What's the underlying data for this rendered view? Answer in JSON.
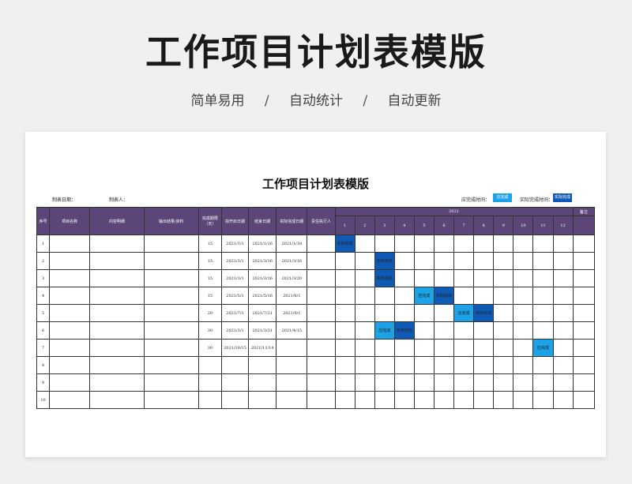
{
  "banner": {
    "title": "工作项目计划表模版",
    "features": [
      "简单易用",
      "自动统计",
      "自动更新"
    ],
    "separator": "/"
  },
  "doc": {
    "title": "工作项目计划表模版",
    "made_date_label": "制表日期：",
    "made_by_label": "制表人：",
    "legend_planned_label": "应完成时间：",
    "legend_planned_box": "应完成",
    "legend_actual_label": "实际完成时间：",
    "legend_actual_box": "实际完成"
  },
  "colors": {
    "header_bg": "#5b4677",
    "planned": "#1ca2e6",
    "actual": "#0f5ab4"
  },
  "table": {
    "headers": {
      "no": "序号",
      "name": "项目名称",
      "detail": "内容明细",
      "output": "输出结果/资料",
      "duration": "完成期限（天）",
      "start": "拟开启日期",
      "end": "结束日期",
      "actual_end": "实际完成日期",
      "owner": "责任执行人",
      "year": "2021",
      "remark": "备注"
    },
    "months": [
      "1",
      "2",
      "3",
      "4",
      "5",
      "6",
      "7",
      "8",
      "9",
      "10",
      "11",
      "12"
    ],
    "rows": [
      {
        "no": "1",
        "duration": "15",
        "start": "2021/1/1",
        "end": "2021/1/16",
        "actual_end": "2021/1/18",
        "planned_months": [],
        "actual_months": [
          1
        ]
      },
      {
        "no": "2",
        "duration": "15",
        "start": "2021/3/1",
        "end": "2021/3/16",
        "actual_end": "2021/3/16",
        "planned_months": [],
        "actual_months": [
          3
        ]
      },
      {
        "no": "3",
        "duration": "15",
        "start": "2021/3/1",
        "end": "2021/3/16",
        "actual_end": "2021/3/20",
        "planned_months": [],
        "actual_months": [
          3
        ]
      },
      {
        "no": "4",
        "duration": "15",
        "start": "2021/5/1",
        "end": "2021/5/16",
        "actual_end": "2021/6/1",
        "planned_months": [
          5
        ],
        "actual_months": [
          6
        ]
      },
      {
        "no": "5",
        "duration": "20",
        "start": "2021/7/1",
        "end": "2021/7/21",
        "actual_end": "2021/8/1",
        "planned_months": [
          7
        ],
        "actual_months": [
          8
        ]
      },
      {
        "no": "6",
        "duration": "30",
        "start": "2021/3/1",
        "end": "2021/3/31",
        "actual_end": "2021/4/15",
        "planned_months": [
          3
        ],
        "actual_months": [
          4
        ]
      },
      {
        "no": "7",
        "duration": "30",
        "start": "2021/10/15",
        "end": "2021/11/14",
        "actual_end": "",
        "planned_months": [
          11
        ],
        "actual_months": []
      },
      {
        "no": "8",
        "duration": "",
        "start": "",
        "end": "",
        "actual_end": "",
        "planned_months": [],
        "actual_months": []
      },
      {
        "no": "9",
        "duration": "",
        "start": "",
        "end": "",
        "actual_end": "",
        "planned_months": [],
        "actual_months": []
      },
      {
        "no": "10",
        "duration": "",
        "start": "",
        "end": "",
        "actual_end": "",
        "planned_months": [],
        "actual_months": []
      }
    ],
    "planned_label": "应完成",
    "actual_label": "实际完成"
  }
}
